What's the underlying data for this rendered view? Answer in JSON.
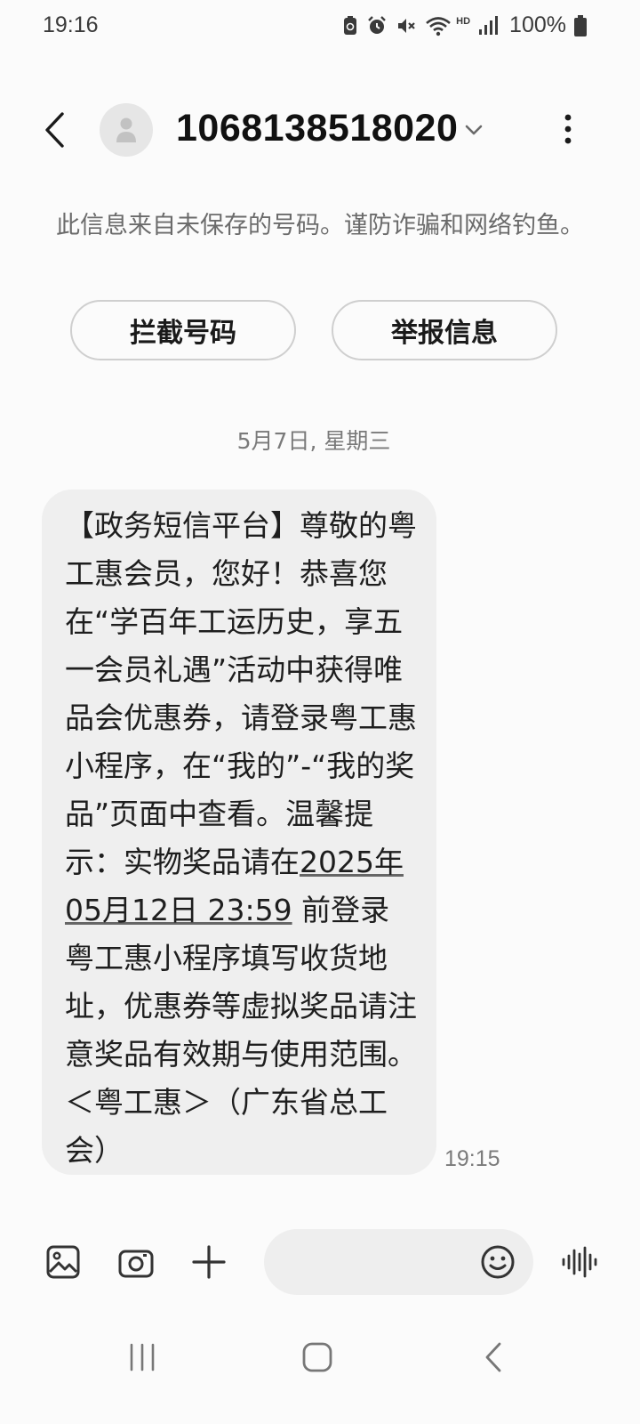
{
  "status_bar": {
    "time": "19:16",
    "battery_percent": "100%",
    "hd_label": "HD",
    "icons": [
      "data-saver-icon",
      "alarm-icon",
      "mute-icon",
      "wifi-icon",
      "signal-icon",
      "battery-icon"
    ]
  },
  "header": {
    "contact_number": "1068138518020",
    "icons": [
      "back-arrow-icon",
      "avatar-person-icon",
      "chevron-down-icon",
      "more-vertical-icon"
    ]
  },
  "warning": {
    "text": "此信息来自未保存的号码。谨防诈骗和网络钓鱼。",
    "block_button": "拦截号码",
    "report_button": "举报信息"
  },
  "conversation": {
    "date": "5月7日, 星期三",
    "message": {
      "text_before": "【政务短信平台】尊敬的粤工惠会员，您好！恭喜您在“学百年工运历史，享五一会员礼遇”活动中获得唯品会优惠券，请登录粤工惠小程序，在“我的”-“我的奖品”页面中查看。温馨提示：实物奖品请在",
      "deadline": "2025年05月12日 23:59",
      "text_after": " 前登录粤工惠小程序填写收货地址，优惠券等虚拟奖品请注意奖品有效期与使用范围。＜粤工惠＞（广东省总工会）",
      "time": "19:15"
    }
  },
  "composer": {
    "input_value": "",
    "icons": [
      "gallery-icon",
      "camera-icon",
      "plus-icon",
      "emoji-icon",
      "voice-waveform-icon"
    ]
  },
  "nav_bar": {
    "icons": [
      "recent-apps-icon",
      "home-icon",
      "back-icon"
    ]
  },
  "colors": {
    "background": "#fbfbfb",
    "bubble": "#efefef",
    "input": "#eeeeee",
    "secondary_text": "#7a7a7a"
  }
}
